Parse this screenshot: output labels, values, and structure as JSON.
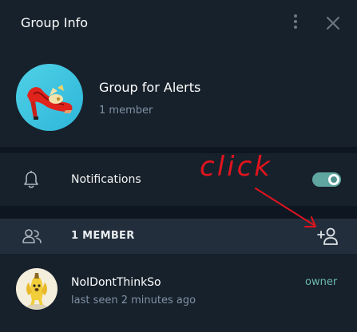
{
  "header": {
    "title": "Group Info",
    "menu_icon": "more-vertical-icon",
    "close_icon": "close-icon"
  },
  "group": {
    "name": "Group for Alerts",
    "subtitle": "1 member",
    "avatar": "red-high-heel-shoe-avatar"
  },
  "notifications": {
    "icon": "bell-icon",
    "label": "Notifications",
    "enabled": true
  },
  "members": {
    "icon": "people-icon",
    "header_label": "1 MEMBER",
    "add_icon": "add-member-icon",
    "list": [
      {
        "name": "NoIDontThinkSo",
        "status": "last seen 2 minutes ago",
        "role": "owner",
        "avatar": "banana-avatar"
      }
    ]
  },
  "annotation": {
    "text": "click",
    "color": "#e0141e"
  },
  "colors": {
    "background": "#17212b",
    "divider": "#0e1621",
    "section_header": "#232e3c",
    "accent": "#5fa6a0",
    "secondary_text": "#7f91a4"
  }
}
